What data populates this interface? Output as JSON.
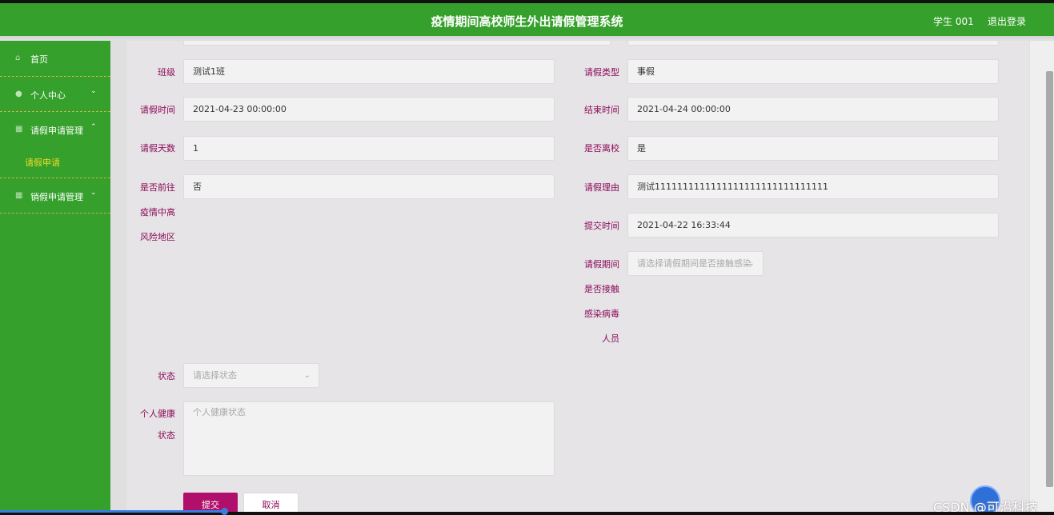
{
  "header": {
    "title": "疫情期间高校师生外出请假管理系统",
    "user": "学生 001",
    "logout": "退出登录"
  },
  "sidebar": {
    "items": [
      {
        "label": "首页",
        "icon": "home-icon"
      },
      {
        "label": "个人中心",
        "icon": "user-icon"
      },
      {
        "label": "请假申请管理",
        "icon": "grid-icon"
      },
      {
        "label": "销假申请管理",
        "icon": "grid-icon"
      }
    ],
    "subitem": "请假申请"
  },
  "form": {
    "class_label": "班级",
    "class_value": "测试1班",
    "leave_type_label": "请假类型",
    "leave_type_value": "事假",
    "start_label": "请假时间",
    "start_value": "2021-04-23 00:00:00",
    "end_label": "结束时间",
    "end_value": "2021-04-24 00:00:00",
    "days_label": "请假天数",
    "days_value": "1",
    "leave_school_label": "是否离校",
    "leave_school_value": "是",
    "risk_area_label_1": "是否前往",
    "risk_area_label_2": "疫情中高",
    "risk_area_label_3": "风险地区",
    "risk_area_value": "否",
    "reason_label": "请假理由",
    "reason_value": "测试1111111111111111111111111111111",
    "submit_time_label": "提交时间",
    "submit_time_value": "2021-04-22 16:33:44",
    "contact_label_1": "请假期间",
    "contact_label_2": "是否接触",
    "contact_label_3": "感染病毒",
    "contact_label_4": "人员",
    "contact_placeholder": "请选择请假期间是否接触感染",
    "status_label": "状态",
    "status_placeholder": "请选择状态",
    "health_label_1": "个人健康",
    "health_label_2": "状态",
    "health_placeholder": "个人健康状态",
    "submit": "提交",
    "cancel": "取消"
  },
  "watermark": "CSDN @可沿科技",
  "colors": {
    "header_bg": "#35a02b",
    "label": "#8b0a5a",
    "submit_bg": "#b0106b",
    "sub_active": "#f0dc2a"
  }
}
